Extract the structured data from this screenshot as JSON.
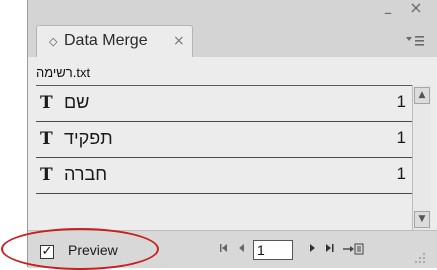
{
  "panel": {
    "tab_title": "Data Merge",
    "tab_close": "×",
    "window_close": "×",
    "window_minimize": "–",
    "menu_icon": "panel-menu-icon"
  },
  "data_source": "רשימה.txt",
  "fields": [
    {
      "type_icon": "T",
      "name": "שם",
      "count": "1"
    },
    {
      "type_icon": "T",
      "name": "תפקיד",
      "count": "1"
    },
    {
      "type_icon": "T",
      "name": "חברה",
      "count": "1"
    }
  ],
  "footer": {
    "preview_label": "Preview",
    "preview_checked": true,
    "checkmark": "✓",
    "record_value": "1",
    "first_record_icon": "first-record-icon",
    "prev_record_icon": "previous-record-icon",
    "next_record_icon": "next-record-icon",
    "last_record_icon": "last-record-icon",
    "create_merged_icon": "create-merged-document-icon"
  },
  "colors": {
    "highlight_ellipse": "#c8201c"
  }
}
